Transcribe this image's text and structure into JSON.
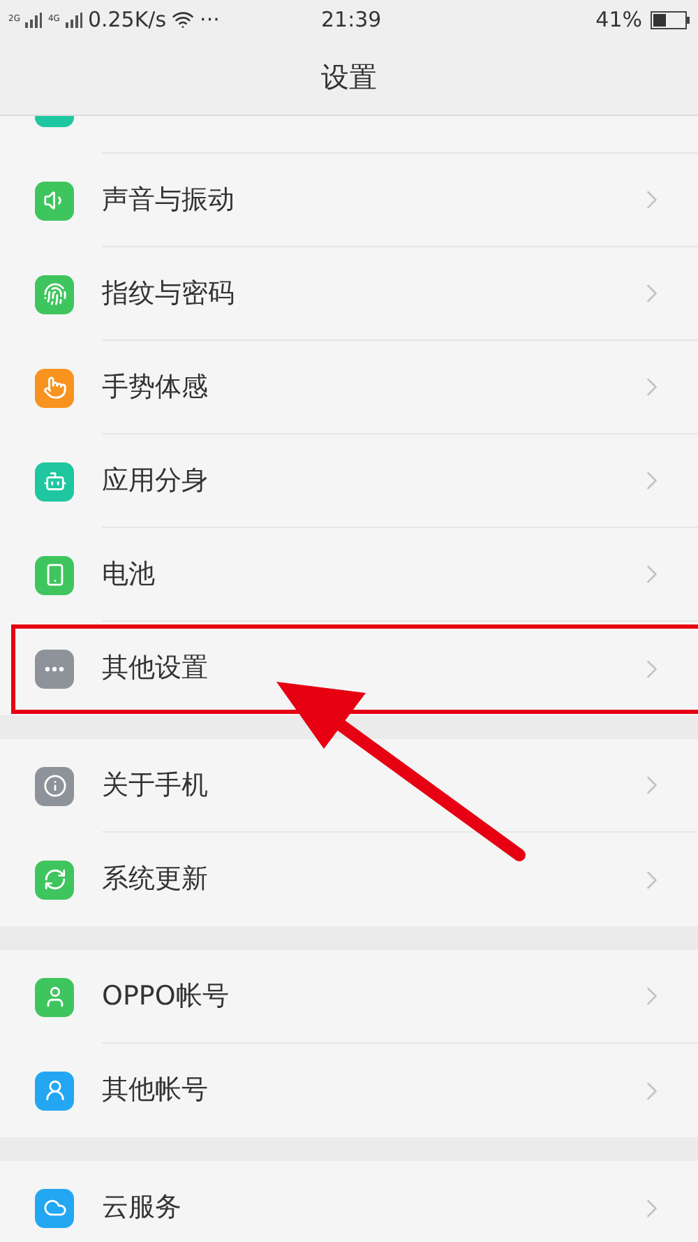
{
  "status_bar": {
    "network_1": "2G",
    "network_2": "4G",
    "speed": "0.25K/s",
    "more": "···",
    "time": "21:39",
    "battery": "41%"
  },
  "title": "设置",
  "groups": [
    {
      "items": [
        {
          "kind": "partial",
          "color": "#1ec79f"
        },
        {
          "label": "声音与振动",
          "color": "#3fc55e",
          "highlighted": false
        },
        {
          "label": "指纹与密码",
          "color": "#3fc55e",
          "highlighted": false
        },
        {
          "label": "手势体感",
          "color": "#f7931e",
          "highlighted": false
        },
        {
          "label": "应用分身",
          "color": "#1ec79f",
          "highlighted": false
        },
        {
          "label": "电池",
          "color": "#3fc55e",
          "highlighted": false
        },
        {
          "label": "其他设置",
          "color": "#8e9399",
          "highlighted": true
        }
      ]
    },
    {
      "items": [
        {
          "label": "关于手机",
          "color": "#8e9399",
          "highlighted": false
        },
        {
          "label": "系统更新",
          "color": "#3fc55e",
          "highlighted": false
        }
      ]
    },
    {
      "items": [
        {
          "label": "OPPO帐号",
          "color": "#3fc55e",
          "highlighted": false
        },
        {
          "label": "其他帐号",
          "color": "#24a7f2",
          "highlighted": false
        }
      ]
    },
    {
      "items": [
        {
          "label": "云服务",
          "color": "#24a7f2",
          "highlighted": false
        }
      ]
    }
  ]
}
